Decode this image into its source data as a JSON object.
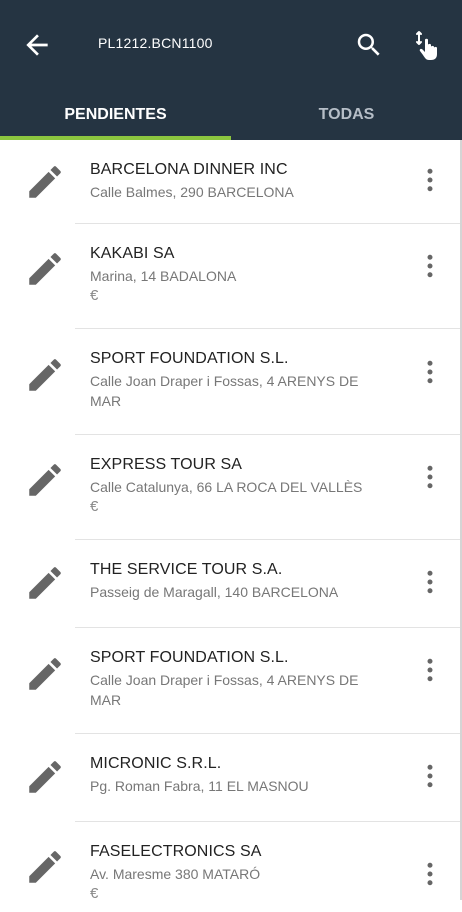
{
  "header": {
    "title": "PL1212.BCN1100",
    "back_icon": "arrow-back-icon",
    "search_icon": "search-icon",
    "touch_icon": "touch-select-icon",
    "background_color": "#253442",
    "indicator_color": "#8cc63f"
  },
  "tabs": [
    {
      "label": "PENDIENTES",
      "selected": true
    },
    {
      "label": "TODAS",
      "selected": false
    }
  ],
  "clients": [
    {
      "name": "BARCELONA DINNER INC",
      "address": "Calle Balmes, 290 BARCELONA",
      "euro": ""
    },
    {
      "name": "KAKABI SA",
      "address": "Marina, 14 BADALONA",
      "euro": "€"
    },
    {
      "name": "SPORT FOUNDATION S.L.",
      "address": "Calle Joan Draper i Fossas, 4 ARENYS DE MAR",
      "euro": ""
    },
    {
      "name": "EXPRESS TOUR SA",
      "address": "Calle Catalunya, 66 LA ROCA DEL VALLÈS",
      "euro": "€"
    },
    {
      "name": "THE SERVICE TOUR S.A.",
      "address": "Passeig de Maragall, 140 BARCELONA",
      "euro": ""
    },
    {
      "name": "SPORT FOUNDATION S.L.",
      "address": "Calle Joan Draper i Fossas, 4 ARENYS DE MAR",
      "euro": ""
    },
    {
      "name": "MICRONIC S.R.L.",
      "address": "Pg. Roman Fabra, 11 EL MASNOU",
      "euro": ""
    },
    {
      "name": "FASELECTRONICS SA",
      "address": "Av. Maresme 380 MATARÓ",
      "euro": "€"
    }
  ]
}
